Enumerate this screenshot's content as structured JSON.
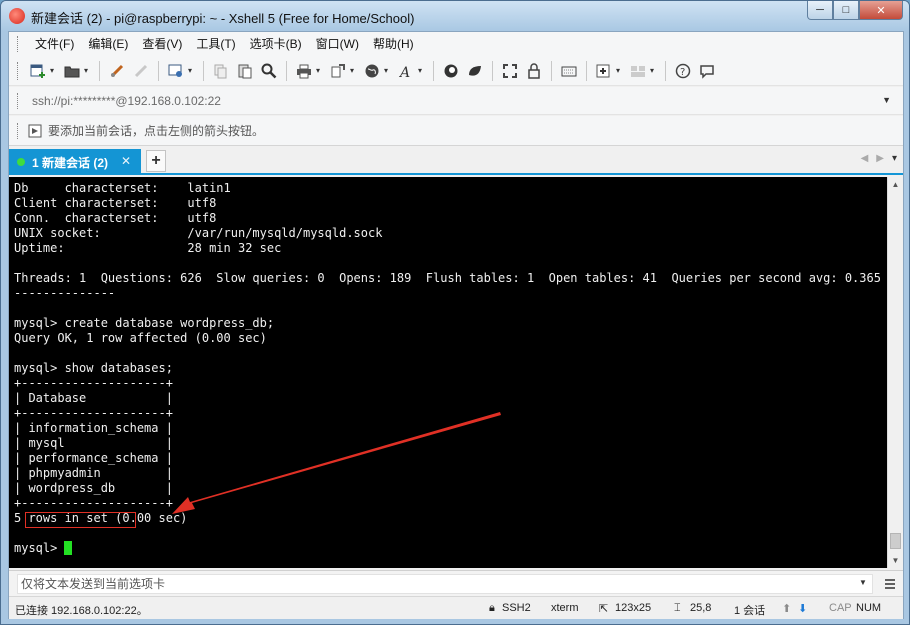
{
  "window": {
    "title": "新建会话 (2) - pi@raspberrypi: ~ - Xshell 5 (Free for Home/School)",
    "minimize": "─",
    "maximize": "□",
    "close": "✕"
  },
  "menu": [
    "文件(F)",
    "编辑(E)",
    "查看(V)",
    "工具(T)",
    "选项卡(B)",
    "窗口(W)",
    "帮助(H)"
  ],
  "toolbar_icons": [
    "new-session-icon",
    "open-folder-icon",
    "disconnect-icon",
    "reconnect-icon",
    "properties-icon",
    "copy-icon",
    "paste-icon",
    "find-icon",
    "print-icon",
    "transfer-icon",
    "globe-icon",
    "font-icon",
    "xftp-icon",
    "xmanager-icon",
    "fullscreen-icon",
    "lock-icon",
    "keyboard-icon",
    "add-icon",
    "layout-icon",
    "help-icon",
    "chat-icon"
  ],
  "address": {
    "value": "ssh://pi:*********@192.168.0.102:22"
  },
  "hint": {
    "text": "要添加当前会话，点击左侧的箭头按钮。"
  },
  "tabs": [
    {
      "label": "1 新建会话 (2)",
      "close": "✕"
    }
  ],
  "tab_add": "+",
  "terminal": {
    "lines": [
      "Db     characterset:    latin1",
      "Client characterset:    utf8",
      "Conn.  characterset:    utf8",
      "UNIX socket:            /var/run/mysqld/mysqld.sock",
      "Uptime:                 28 min 32 sec",
      "",
      "Threads: 1  Questions: 626  Slow queries: 0  Opens: 189  Flush tables: 1  Open tables: 41  Queries per second avg: 0.365",
      "--------------",
      "",
      "mysql> create database wordpress_db;",
      "Query OK, 1 row affected (0.00 sec)",
      "",
      "mysql> show databases;",
      "+--------------------+",
      "| Database           |",
      "+--------------------+",
      "| information_schema |",
      "| mysql              |",
      "| performance_schema |",
      "| phpmyadmin         |",
      "| wordpress_db       |",
      "+--------------------+",
      "5 rows in set (0.00 sec)",
      "",
      "mysql> "
    ]
  },
  "sendbar": {
    "placeholder": "仅将文本发送到当前选项卡"
  },
  "status": {
    "connection": "已连接 192.168.0.102:22。",
    "protocol": "SSH2",
    "terminal_type": "xterm",
    "size": "123x25",
    "cursor_pos": "25,8",
    "sessions": "1 会话",
    "caps": "CAP",
    "num": "NUM"
  },
  "colors": {
    "tab_active": "#1495d4",
    "terminal_bg": "#000000",
    "terminal_fg": "#f0f0f0",
    "cursor": "#23e023",
    "annotation": "#e03025"
  }
}
